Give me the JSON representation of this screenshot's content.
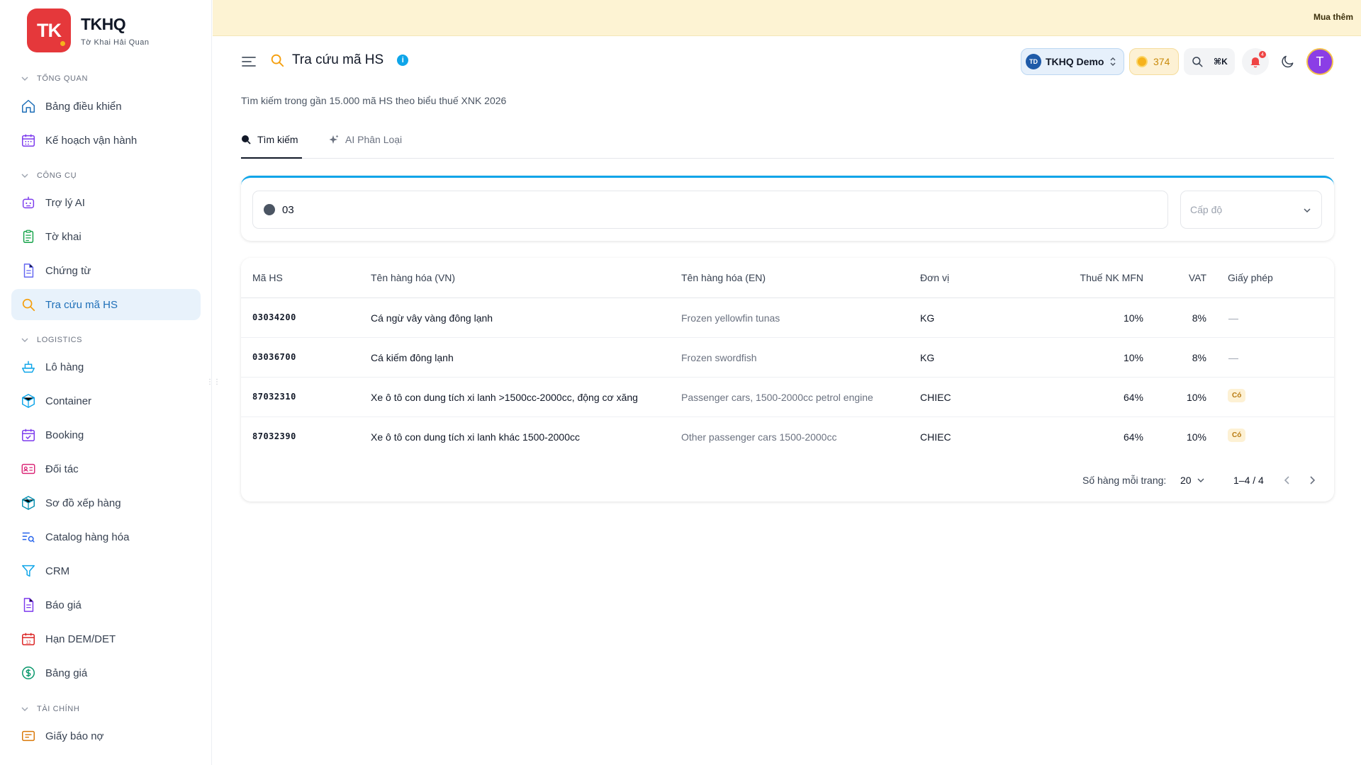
{
  "brand": {
    "logo_text": "TK",
    "name": "TKHQ",
    "subtitle": "Tờ Khai Hải Quan"
  },
  "sidebar": {
    "sections": [
      {
        "title": "TỔNG QUAN"
      },
      {
        "title": "CÔNG CỤ"
      },
      {
        "title": "LOGISTICS"
      },
      {
        "title": "TÀI CHÍNH"
      }
    ],
    "items": [
      {
        "label": "Bảng điều khiển",
        "icon": "home-icon"
      },
      {
        "label": "Kế hoạch vận hành",
        "icon": "calendar-icon"
      },
      {
        "label": "Trợ lý AI",
        "icon": "bot-icon"
      },
      {
        "label": "Tờ khai",
        "icon": "clipboard-icon"
      },
      {
        "label": "Chứng từ",
        "icon": "document-icon"
      },
      {
        "label": "Tra cứu mã HS",
        "icon": "search-icon"
      },
      {
        "label": "Lô hàng",
        "icon": "ship-icon"
      },
      {
        "label": "Container",
        "icon": "box-icon"
      },
      {
        "label": "Booking",
        "icon": "calendar-check-icon"
      },
      {
        "label": "Đối tác",
        "icon": "contact-card-icon"
      },
      {
        "label": "Sơ đồ xếp hàng",
        "icon": "package-icon"
      },
      {
        "label": "Catalog hàng hóa",
        "icon": "list-search-icon"
      },
      {
        "label": "CRM",
        "icon": "funnel-icon"
      },
      {
        "label": "Báo giá",
        "icon": "file-text-icon"
      },
      {
        "label": "Hạn DEM/DET",
        "icon": "calendar-12-icon"
      },
      {
        "label": "Bảng giá",
        "icon": "dollar-circle-icon"
      },
      {
        "label": "Giấy báo nợ",
        "icon": "receipt-icon"
      }
    ]
  },
  "banner": {
    "action_label": "Mua thêm"
  },
  "header": {
    "title": "Tra cứu mã HS",
    "info_glyph": "i",
    "org_initials": "TD",
    "org_name": "TKHQ Demo",
    "credits": "374",
    "search_shortcut": "⌘K",
    "notification_count": "4",
    "user_initial": "T"
  },
  "subtitle": "Tìm kiếm trong gần 15.000 mã HS theo biểu thuế XNK 2026",
  "tabs": [
    {
      "label": "Tìm kiếm",
      "active": true
    },
    {
      "label": "AI Phân Loại",
      "active": false
    }
  ],
  "search": {
    "value": "03",
    "level_placeholder": "Cấp độ"
  },
  "table": {
    "columns": [
      "Mã HS",
      "Tên hàng hóa (VN)",
      "Tên hàng hóa (EN)",
      "Đơn vị",
      "Thuế NK MFN",
      "VAT",
      "Giấy phép"
    ],
    "rows": [
      {
        "code": "03034200",
        "name_vn": "Cá ngừ vây vàng đông lạnh",
        "name_en": "Frozen yellowfin tunas",
        "unit": "KG",
        "mfn": "10%",
        "vat": "8%",
        "license": "—"
      },
      {
        "code": "03036700",
        "name_vn": "Cá kiếm đông lạnh",
        "name_en": "Frozen swordfish",
        "unit": "KG",
        "mfn": "10%",
        "vat": "8%",
        "license": "—"
      },
      {
        "code": "87032310",
        "name_vn": "Xe ô tô con dung tích xi lanh >1500cc-2000cc, động cơ xăng",
        "name_en": "Passenger cars, 1500-2000cc petrol engine",
        "unit": "CHIEC",
        "mfn": "64%",
        "vat": "10%",
        "license": "Có"
      },
      {
        "code": "87032390",
        "name_vn": "Xe ô tô con dung tích xi lanh khác 1500-2000cc",
        "name_en": "Other passenger cars 1500-2000cc",
        "unit": "CHIEC",
        "mfn": "64%",
        "vat": "10%",
        "license": "Có"
      }
    ]
  },
  "pagination": {
    "rows_per_page_label": "Số hàng mỗi trang:",
    "rows_per_page": "20",
    "range": "1–4 / 4"
  },
  "colors": {
    "accent": "#0ea5e9",
    "brand": "#e5383b",
    "active_nav_bg": "#e8f2fb",
    "banner_bg": "#fdf3d3"
  }
}
